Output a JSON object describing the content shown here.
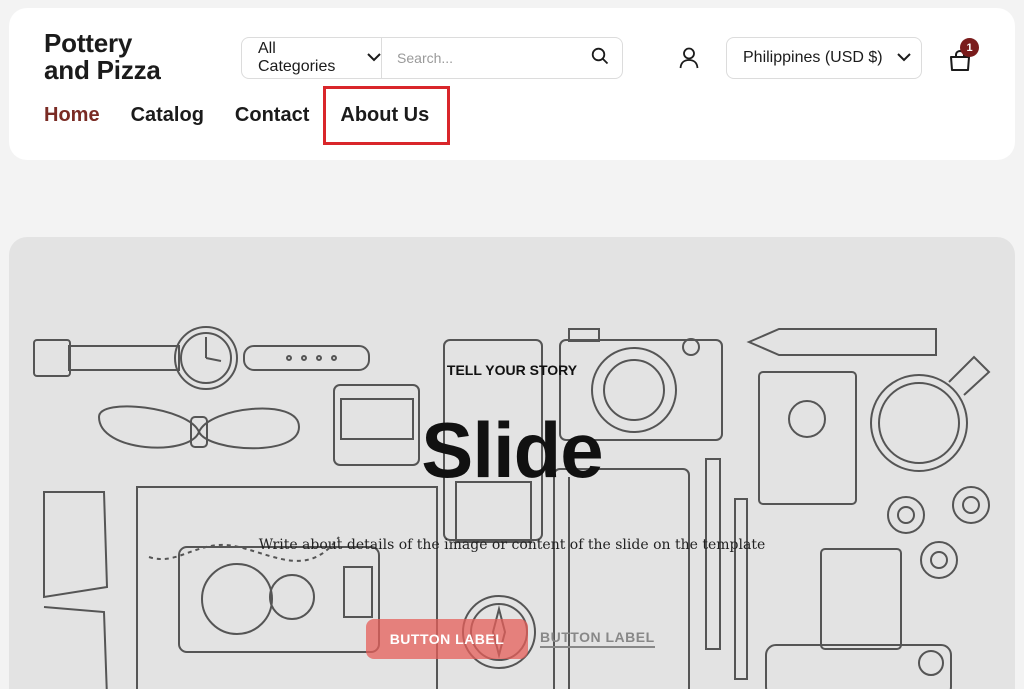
{
  "header": {
    "logo_line1": "Pottery",
    "logo_line2": "and Pizza",
    "search": {
      "category": "All Categories",
      "placeholder": "Search..."
    },
    "country": "Philippines (USD $)",
    "cart_count": "1"
  },
  "nav": {
    "items": [
      {
        "label": "Home"
      },
      {
        "label": "Catalog"
      },
      {
        "label": "Contact"
      },
      {
        "label": "About Us"
      }
    ]
  },
  "hero": {
    "eyebrow": "TELL YOUR STORY",
    "title": "Slide",
    "description": "Write about details of the image or content of the slide on the template",
    "button_primary": "BUTTON LABEL",
    "button_secondary": "BUTTON LABEL"
  },
  "colors": {
    "accent": "#7a2b24",
    "highlight_box": "#d9262a",
    "hero_bg": "#e3e3e3",
    "badge": "#7a1c1c"
  }
}
